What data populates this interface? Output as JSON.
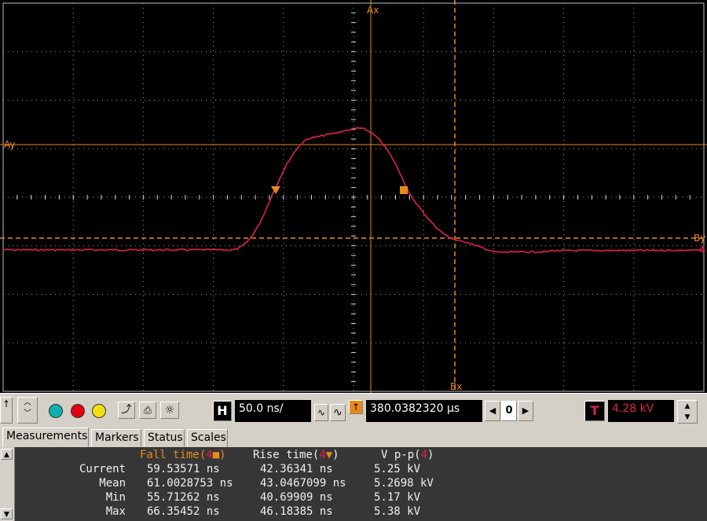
{
  "scope": {
    "trace_color": "#e0204c",
    "grid_color": "#d8d8d8",
    "cursor_color": "#e88a1a",
    "cursor_labels": {
      "ax": "Ax",
      "ay": "Ay",
      "bx": "Bx",
      "by": "By"
    },
    "channel_marker": "4"
  },
  "toolbar": {
    "horizontal_label": "H",
    "timebase": "50.0 ns/",
    "position": "380.0382320 µs",
    "stepper_value": "0",
    "trigger_label": "T",
    "trigger_level": "4.28 kV"
  },
  "tabs": [
    {
      "label": "Measurements",
      "active": true
    },
    {
      "label": "Markers",
      "active": false
    },
    {
      "label": "Status",
      "active": false
    },
    {
      "label": "Scales",
      "active": false
    }
  ],
  "measurements": {
    "headers": [
      {
        "prefix": "Fall time(",
        "ch": "4",
        "sym": "■",
        "suffix": ")"
      },
      {
        "prefix": "Rise time(",
        "ch": "4",
        "sym": "▼",
        "suffix": ")"
      },
      {
        "prefix": "V p-p(",
        "ch": "4",
        "sym": "",
        "suffix": ")"
      }
    ],
    "rows": [
      {
        "label": "Current",
        "fall": "59.53571 ns",
        "rise": "42.36341 ns",
        "vpp": "5.25 kV"
      },
      {
        "label": "Mean",
        "fall": "61.0028753 ns",
        "rise": "43.0467099 ns",
        "vpp": "5.2698 kV"
      },
      {
        "label": "Min",
        "fall": "55.71262 ns",
        "rise": "40.69909 ns",
        "vpp": "5.17 kV"
      },
      {
        "label": "Max",
        "fall": "66.35452 ns",
        "rise": "46.18385 ns",
        "vpp": "5.38 kV"
      }
    ]
  }
}
